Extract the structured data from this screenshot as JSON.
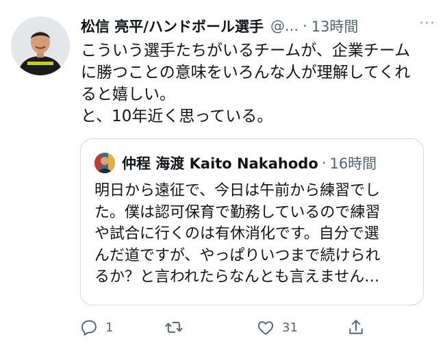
{
  "tweet": {
    "author_name": "松信 亮平/ハンドボール選手",
    "handle": "@...",
    "time": "13時間",
    "more_label": "···",
    "body_lines": [
      "こういう選手たちがいるチームが、企業チーム",
      "に勝つことの意味をいろんな人が理解してくれ",
      "ると嬉しい。",
      "と、10年近く思っている。"
    ]
  },
  "quote": {
    "author_name": "仲程 海渡 Kaito Nakahodo",
    "time": "16時間",
    "body_lines": [
      "明日から遠征で、今日は午前から練習でし",
      "た。僕は認可保育で勤務しているので練習",
      "や試合に行くのは有休消化です。自分で選",
      "んだ道ですが、やっぱりいつまで続けられ",
      "るか？と言われたらなんとも言えません…"
    ]
  },
  "actions": {
    "reply_count": "1",
    "retweet_count": "",
    "like_count": "31"
  },
  "icons": {
    "reply": "reply-icon",
    "retweet": "retweet-icon",
    "like": "like-icon",
    "share": "share-icon",
    "more": "more-icon"
  },
  "colors": {
    "text": "#0f1419",
    "secondary": "#536471",
    "border": "#cfd9de"
  }
}
